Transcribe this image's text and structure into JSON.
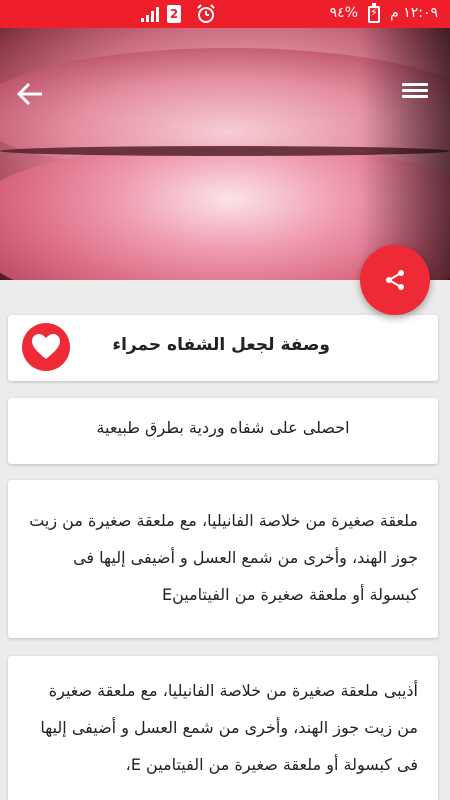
{
  "status_bar": {
    "time": "١٢:٠٩ م",
    "battery_percent": "%٩٤",
    "sim_label": "2",
    "colors": {
      "background": "#ee1f2b",
      "icon": "#ffffff"
    }
  },
  "hero": {
    "back_icon": "arrow-left-icon",
    "menu_icon": "hamburger-menu-icon",
    "share_icon": "share-icon"
  },
  "recipe": {
    "title": "وصفة لجعل الشفاه حمراء",
    "subtitle": "احصلى على شفاه وردية بطرق طبيعية",
    "steps": [
      "ملعقة صغيرة من خلاصة الفانيليا، مع ملعقة صغيرة من زيت جوز الهند، وأخرى من شمع العسل و أضيفى إليها فى كبسولة أو ملعقة صغيرة من الفيتامينE",
      "أذيبى ملعقة صغيرة من خلاصة الفانيليا، مع ملعقة صغيرة من زيت جوز الهند، وأخرى من شمع العسل و أضيفى إليها فى كبسولة أو ملعقة صغيرة من الفيتامين E،"
    ]
  },
  "colors": {
    "accent": "#ee2a36",
    "page_background": "#ececec",
    "card_background": "#ffffff"
  }
}
